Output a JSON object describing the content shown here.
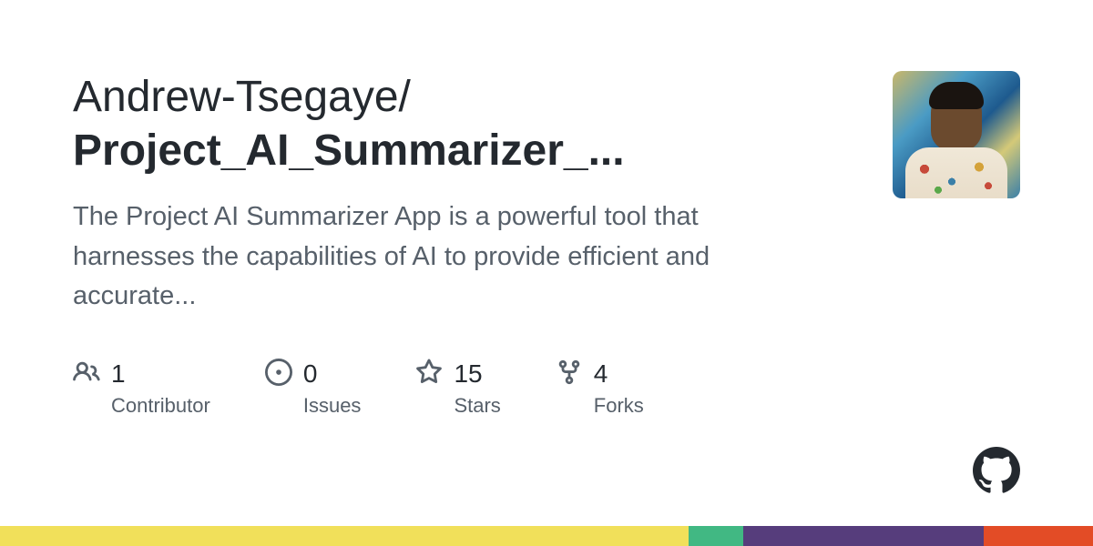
{
  "repo": {
    "owner": "Andrew-Tsegaye",
    "separator": "/",
    "name": "Project_AI_Summarizer_...",
    "description": "The Project AI Summarizer App is a powerful tool that harnesses the capabilities of AI to provide efficient and accurate..."
  },
  "stats": {
    "contributors": {
      "value": "1",
      "label": "Contributor"
    },
    "issues": {
      "value": "0",
      "label": "Issues"
    },
    "stars": {
      "value": "15",
      "label": "Stars"
    },
    "forks": {
      "value": "4",
      "label": "Forks"
    }
  },
  "stripe_colors": {
    "yellow": "#f1e05a",
    "teal": "#41b883",
    "purple": "#563d7c",
    "orange": "#e34c26"
  },
  "stripe_widths": {
    "yellow": "63%",
    "teal": "5%",
    "purple": "22%",
    "orange": "10%"
  }
}
